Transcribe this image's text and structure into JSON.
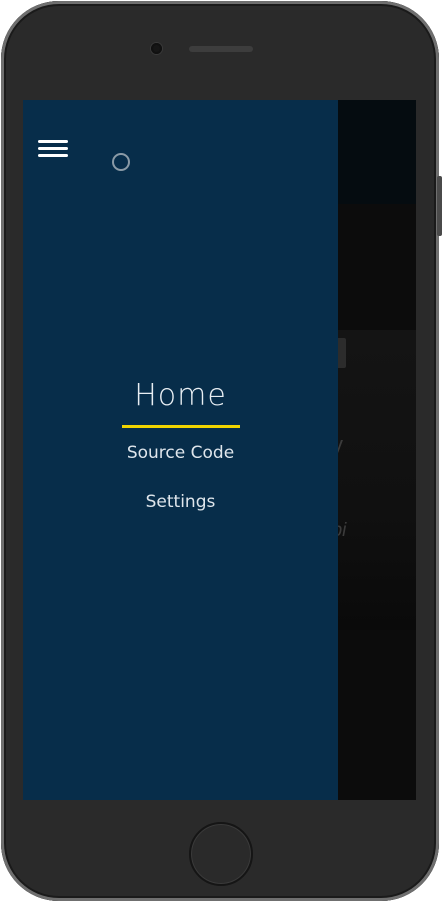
{
  "drawer": {
    "menu_icon": "hamburger-menu-icon",
    "loading_icon": "loading-spinner-icon",
    "items": [
      {
        "label": "Home",
        "active": true
      },
      {
        "label": "Source Code",
        "active": false
      },
      {
        "label": "Settings",
        "active": false
      }
    ],
    "active_indicator_color": "#f0d400",
    "background_color": "#072d4a"
  },
  "background_page": {
    "partial_title": "ity",
    "partial_subtitle": "api"
  }
}
